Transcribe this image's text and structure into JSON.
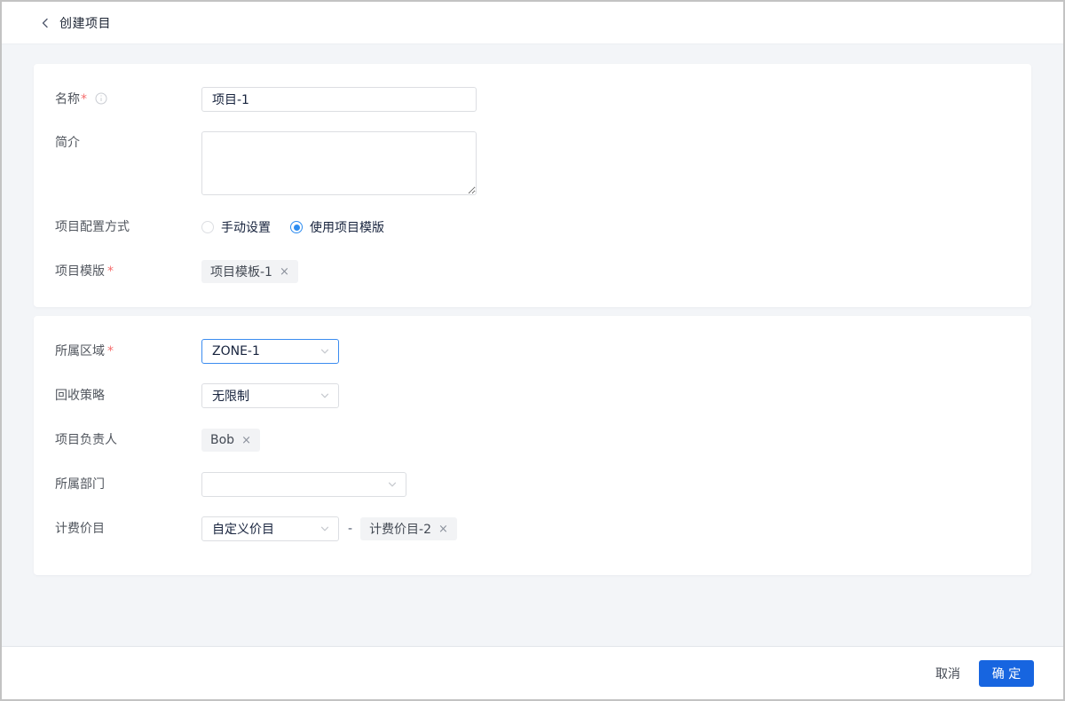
{
  "header": {
    "title": "创建项目",
    "back_icon": "chevron-left"
  },
  "card_basic": {
    "name": {
      "label": "名称",
      "required_mark": "*",
      "value": "项目-1",
      "info_icon": "info-circle"
    },
    "intro": {
      "label": "简介",
      "value": ""
    },
    "config_mode": {
      "label": "项目配置方式",
      "options": [
        {
          "label": "手动设置",
          "selected": false
        },
        {
          "label": "使用项目模版",
          "selected": true
        }
      ]
    },
    "template": {
      "label": "项目模版",
      "required_mark": "*",
      "tag": "项目模板-1",
      "remove_icon": "×"
    }
  },
  "card_settings": {
    "zone": {
      "label": "所属区域",
      "required_mark": "*",
      "value": "ZONE-1"
    },
    "recycle_policy": {
      "label": "回收策略",
      "value": "无限制"
    },
    "owner": {
      "label": "项目负责人",
      "tag": "Bob",
      "remove_icon": "×"
    },
    "department": {
      "label": "所属部门",
      "value": ""
    },
    "billing": {
      "label": "计费价目",
      "value": "自定义价目",
      "separator": "-",
      "tag": "计费价目-2",
      "remove_icon": "×"
    }
  },
  "footer": {
    "cancel_label": "取消",
    "confirm_label": "确 定"
  },
  "colors": {
    "accent_blue": "#1765e0",
    "focus_blue": "#2d8cf0",
    "required_red": "#f56c6c",
    "tag_background": "#f2f3f5",
    "page_background": "#f3f5f8"
  }
}
